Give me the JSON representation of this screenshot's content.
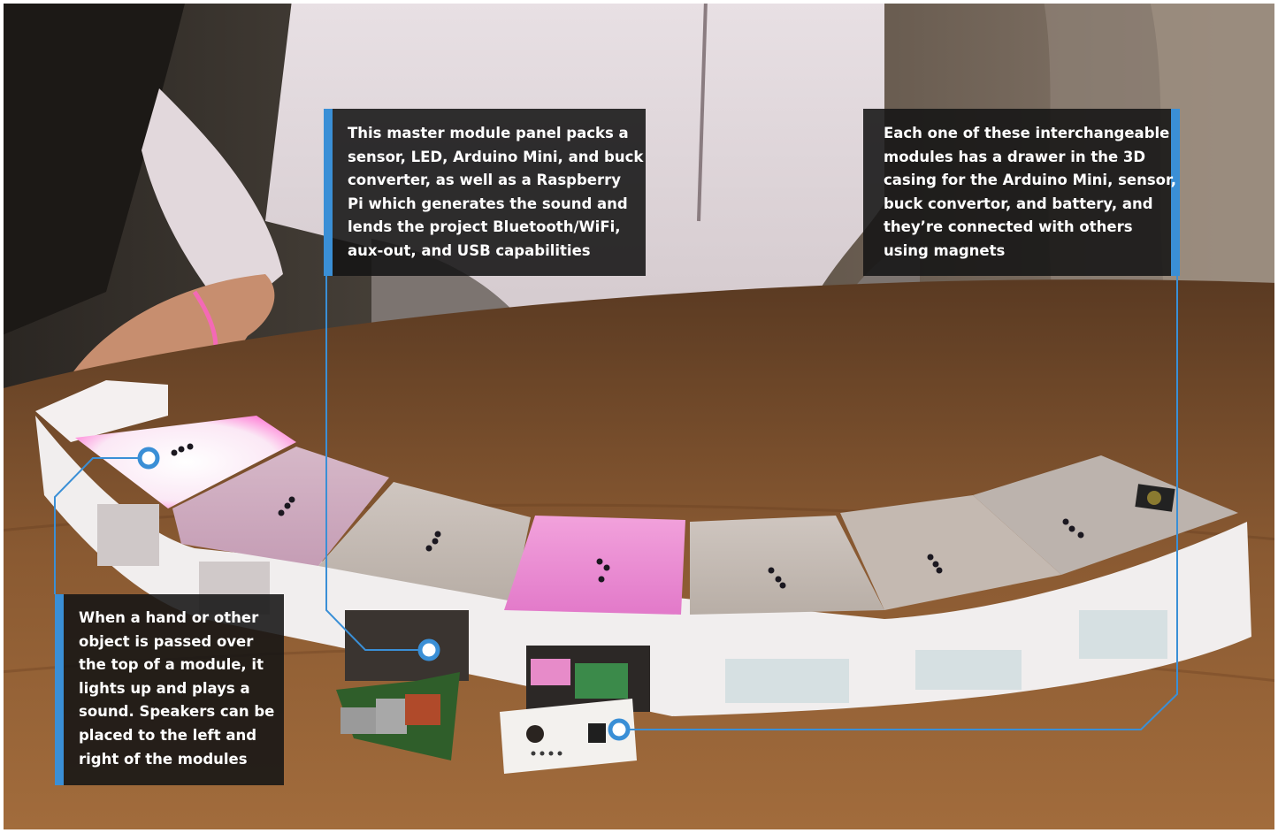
{
  "callouts": {
    "master": {
      "lines": [
        "This master module panel packs a",
        "sensor, LED, Arduino Mini, and buck",
        "converter, as well as a Raspberry",
        "Pi which generates the sound and",
        "lends the project Bluetooth/WiFi,",
        "aux-out, and USB capabilities"
      ]
    },
    "modules": {
      "lines": [
        "Each one of these interchangeable",
        "modules has a drawer in the 3D",
        "casing for the Arduino Mini, sensor,",
        "buck convertor, and battery, and",
        "they’re connected with others",
        "using magnets"
      ]
    },
    "hand": {
      "lines": [
        "When a hand or other",
        "object is passed over",
        "the top of a module, it",
        "lights up and plays a",
        "sound. Speakers can be",
        "placed to the left and",
        "right of the modules"
      ]
    }
  },
  "colors": {
    "accent": "#3a8fd6",
    "callout_bg": "#141414",
    "pink_glow": "#ff4fc0",
    "table_wood": "#8a5a32"
  }
}
